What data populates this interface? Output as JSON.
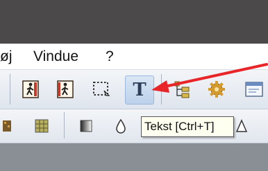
{
  "menubar": {
    "items": [
      "øj",
      "Vindue",
      "?"
    ]
  },
  "toolbar": {
    "text_tool_glyph": "T",
    "tooltip": "Tekst [Ctrl+T]"
  },
  "colors": {
    "title_bar": "#4b4949",
    "arrow": "#e8262a",
    "tooltip_bg": "#fffff0"
  }
}
